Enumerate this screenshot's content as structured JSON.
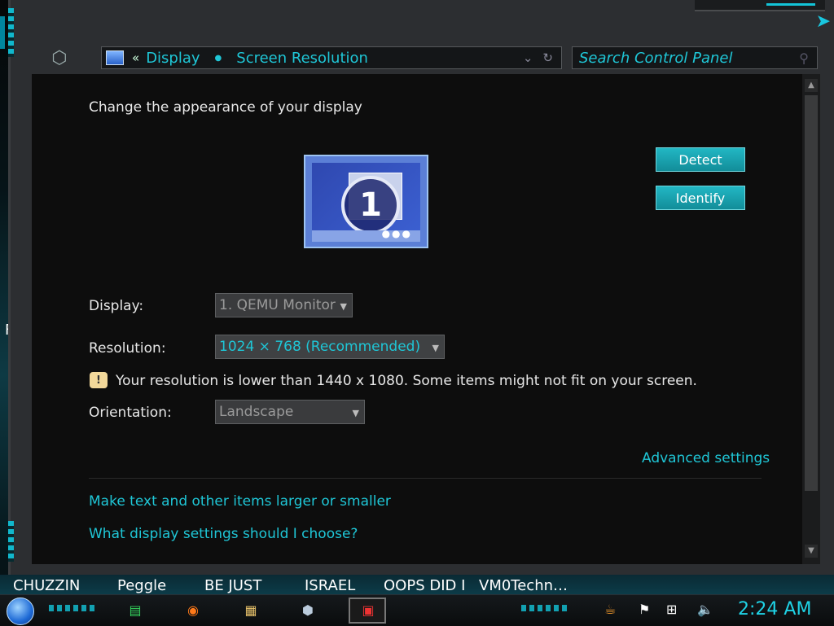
{
  "window": {
    "breadcrumb": {
      "separator": "«",
      "items": [
        "Display",
        "Screen Resolution"
      ]
    },
    "search_placeholder": "Search Control Panel"
  },
  "content": {
    "heading": "Change the appearance of your display",
    "monitor_number": "1",
    "buttons": {
      "detect": "Detect",
      "identify": "Identify"
    },
    "display_label": "Display:",
    "display_value": "1. QEMU Monitor",
    "resolution_label": "Resolution:",
    "resolution_value": "1024 × 768 (Recommended)",
    "warning": "Your resolution is lower than 1440 x 1080. Some items might not fit on your screen.",
    "orientation_label": "Orientation:",
    "orientation_value": "Landscape",
    "advanced_link": "Advanced settings",
    "links": [
      "Make text and other items larger or smaller",
      "What display settings should I choose?"
    ]
  },
  "desktop": {
    "left_glyph": "F"
  },
  "taskbar": {
    "labels": [
      "CHUZZIN",
      "Peggle",
      "BE JUST",
      "ISRAEL",
      "OOPS DID I",
      "VM0Techn…"
    ],
    "clock": "2:24 AM",
    "accent_color": "#1fc6d6"
  }
}
